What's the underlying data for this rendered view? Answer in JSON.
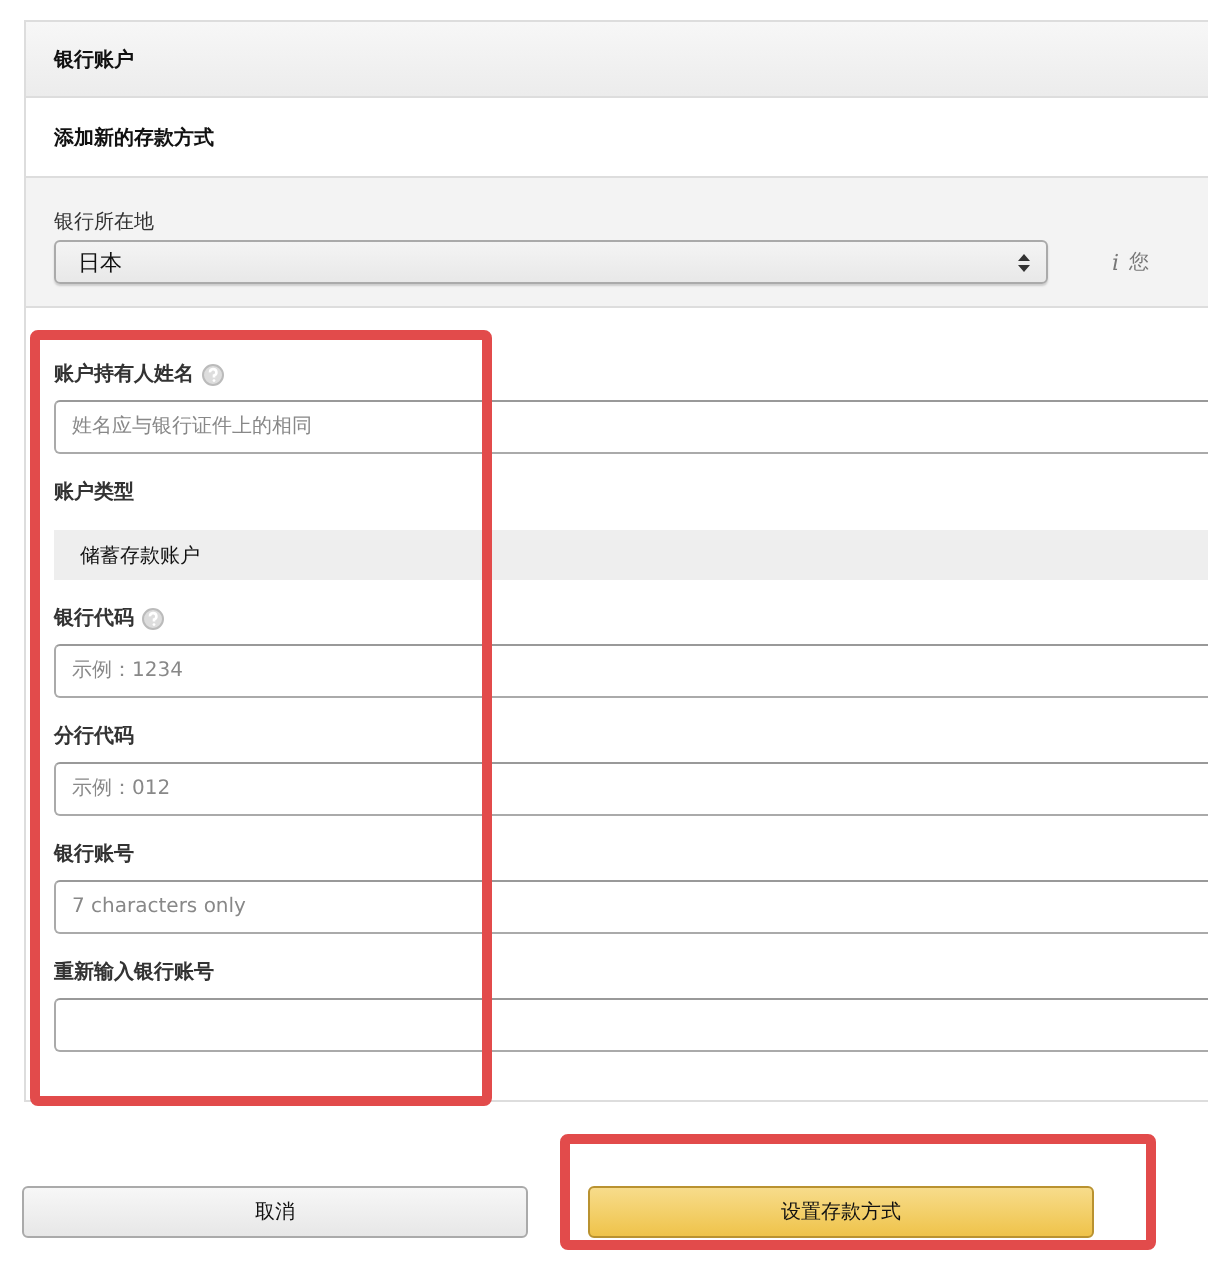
{
  "panel": {
    "title": "银行账户",
    "subtitle": "添加新的存款方式"
  },
  "location": {
    "label": "银行所在地",
    "value": "日本",
    "info": "i",
    "note": "您"
  },
  "fields": [
    {
      "kind": "input",
      "label": "账户持有人姓名",
      "help": true,
      "placeholder": "姓名应与银行证件上的相同"
    },
    {
      "kind": "static",
      "label": "账户类型",
      "value": "储蓄存款账户"
    },
    {
      "kind": "input",
      "label": "银行代码",
      "help": true,
      "placeholder": "示例：1234"
    },
    {
      "kind": "input",
      "label": "分行代码",
      "placeholder": "示例：012"
    },
    {
      "kind": "input",
      "label": "银行账号",
      "placeholder": "7 characters only"
    },
    {
      "kind": "input",
      "label": "重新输入银行账号"
    }
  ],
  "buttons": [
    {
      "label": "取消",
      "kind": "secondary"
    },
    {
      "label": "设置存款方式",
      "kind": "primary"
    }
  ]
}
